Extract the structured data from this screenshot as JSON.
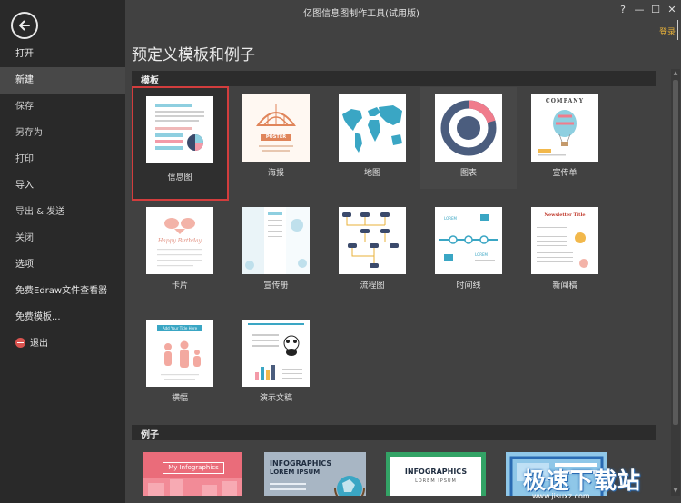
{
  "window": {
    "title": "亿图信息图制作工具(试用版)",
    "login": "登录",
    "controls": {
      "help": "?",
      "minimize": "—",
      "maximize": "☐",
      "close": "✕"
    }
  },
  "sidebar": {
    "items": [
      {
        "label": "打开"
      },
      {
        "label": "新建"
      },
      {
        "label": "保存"
      },
      {
        "label": "另存为"
      },
      {
        "label": "打印"
      },
      {
        "label": "导入"
      },
      {
        "label": "导出 & 发送"
      },
      {
        "label": "关闭"
      },
      {
        "label": "选项"
      },
      {
        "label": "免费Edraw文件查看器"
      },
      {
        "label": "免费模板..."
      },
      {
        "label": "退出"
      }
    ]
  },
  "main": {
    "title": "预定义模板和例子",
    "templates_header": "模板",
    "templates": [
      {
        "label": "信息图"
      },
      {
        "label": "海报"
      },
      {
        "label": "地图"
      },
      {
        "label": "图表"
      },
      {
        "label": "宣传单"
      },
      {
        "label": "卡片"
      },
      {
        "label": "宣传册"
      },
      {
        "label": "流程图"
      },
      {
        "label": "时间线"
      },
      {
        "label": "新闻稿"
      },
      {
        "label": "横幅"
      },
      {
        "label": "演示文稿"
      }
    ],
    "examples_header": "例子",
    "examples": [
      {
        "text": "My Infographics"
      },
      {
        "text": "INFOGRAPHICS",
        "sub": "LOREM IPSUM"
      },
      {
        "text": "INFOGRAPHICS",
        "sub": "LOREM IPSUM"
      },
      {
        "text": ""
      }
    ]
  },
  "thumb_text": {
    "company": "COMPANY",
    "poster": "POSTER",
    "happy": "Happy Birthday",
    "newsletter": "Newsletter Title",
    "banner": "Add Your Title Here",
    "lorem": "LOREM"
  },
  "watermark": {
    "text": "极速下载站",
    "url": "www.jisuxz.com"
  },
  "colors": {
    "accent": "#d23d3d",
    "login": "#e8b23a",
    "sidebar": "#292929",
    "background": "#414141"
  }
}
